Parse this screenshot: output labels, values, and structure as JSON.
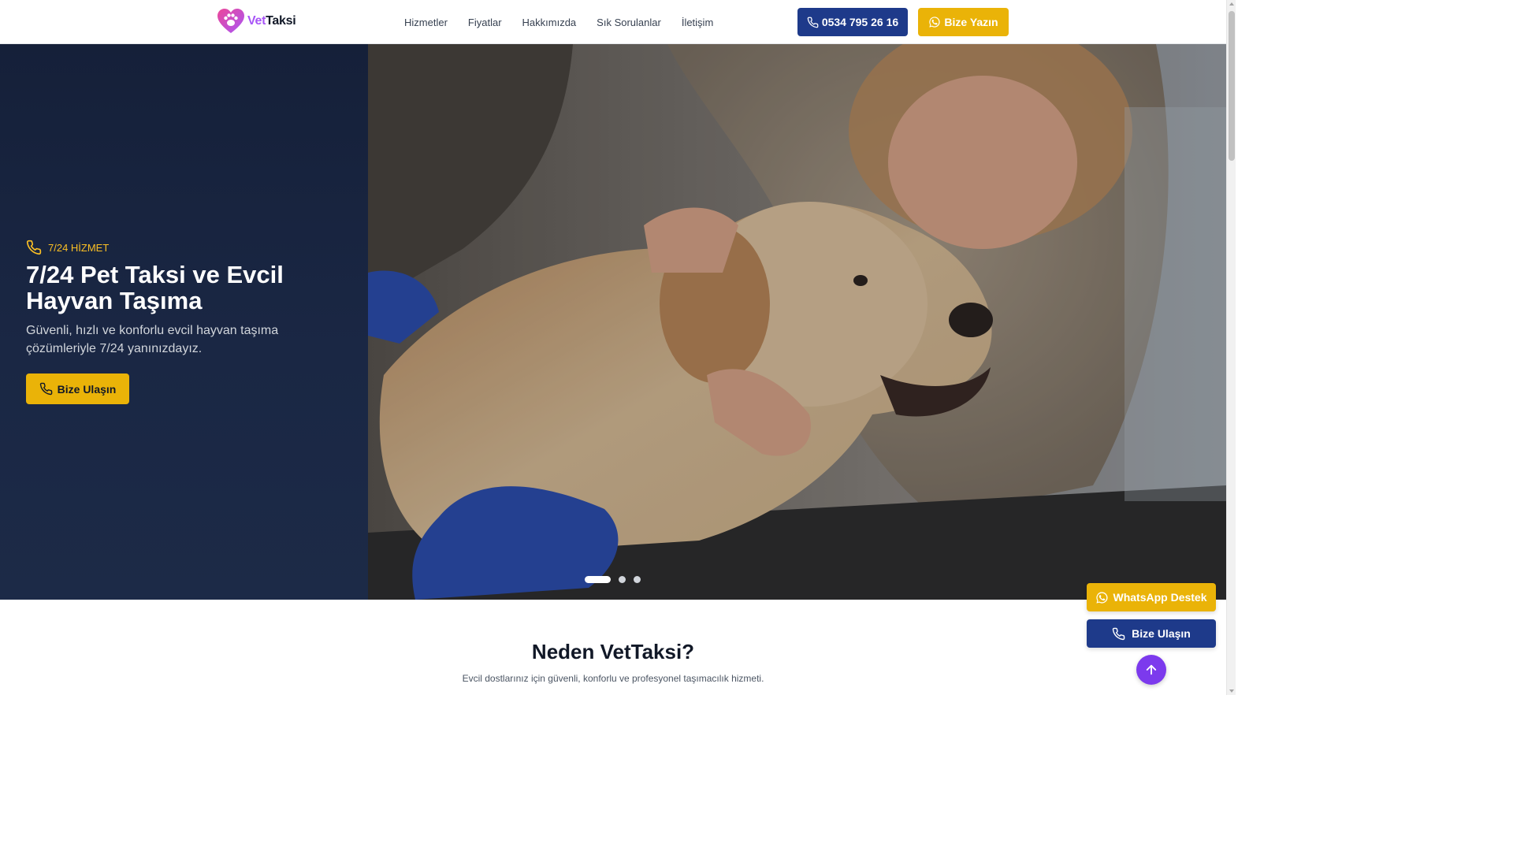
{
  "brand": {
    "name_part1": "Vet",
    "name_part2": "Taksi"
  },
  "nav": {
    "items": [
      {
        "label": "Hizmetler"
      },
      {
        "label": "Fiyatlar"
      },
      {
        "label": "Hakkımızda"
      },
      {
        "label": "Sık Sorulanlar"
      },
      {
        "label": "İletişim"
      }
    ]
  },
  "header_actions": {
    "phone_label": "0534 795 26 16",
    "phone_icon": "phone-icon",
    "write_label": "Bize Yazın",
    "write_icon": "whatsapp-icon"
  },
  "hero": {
    "badge": "7/24 HİZMET",
    "title": "7/24 Pet Taksi ve Evcil Hayvan Taşıma",
    "description": "Güvenli, hızlı ve konforlu evcil hayvan taşıma çözümleriyle 7/24 yanınızdayız.",
    "cta_label": "Bize Ulaşın",
    "slides_total": 3,
    "active_slide": 1
  },
  "section": {
    "title": "Neden VetTaksi?",
    "subtitle": "Evcil dostlarınız için güvenli, konforlu ve profesyonel taşımacılık hizmeti."
  },
  "floating": {
    "whatsapp_label": "WhatsApp Destek",
    "call_label": "Bize Ulaşın",
    "top_icon": "arrow-up-icon"
  },
  "colors": {
    "primary_navy": "#1e3a8a",
    "accent_yellow": "#eab308",
    "brand_purple": "#a855f7",
    "scroll_top_purple": "#7c3aed",
    "hero_dark": "#1a2744"
  }
}
